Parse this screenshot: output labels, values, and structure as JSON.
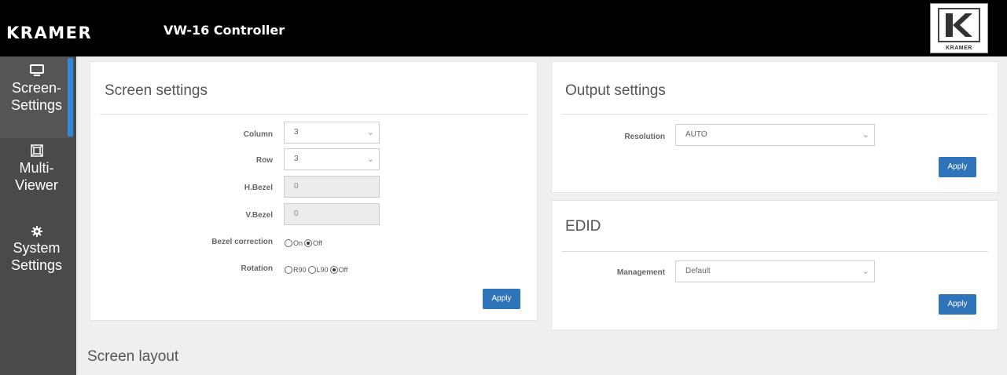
{
  "header": {
    "brand": "KRAMER",
    "app_title": "VW-16 Controller",
    "logo_text": "KRAMER",
    "background": "#000000"
  },
  "sidebar": {
    "accent": "#2f8ad8",
    "items": [
      {
        "line1": "Screen-",
        "line2": "Settings",
        "icon": "monitor-icon",
        "active": true
      },
      {
        "line1": "Multi-",
        "line2": "Viewer",
        "icon": "multiviewer-icon",
        "active": false
      },
      {
        "line1": "System",
        "line2": "Settings",
        "icon": "gear-icon",
        "active": false
      }
    ]
  },
  "screen_settings": {
    "title": "Screen settings",
    "column_label": "Column",
    "column_value": "3",
    "row_label": "Row",
    "row_value": "3",
    "hbezel_label": "H.Bezel",
    "hbezel_value": "0",
    "vbezel_label": "V.Bezel",
    "vbezel_value": "0",
    "bezel_correction_label": "Bezel correction",
    "bezel_correction_options": [
      "On",
      "Off"
    ],
    "bezel_correction_selected": "Off",
    "rotation_label": "Rotation",
    "rotation_options": [
      "R90",
      "L90",
      "Off"
    ],
    "rotation_selected": "Off",
    "apply_label": "Apply"
  },
  "output_settings": {
    "title": "Output settings",
    "resolution_label": "Resolution",
    "resolution_value": "AUTO",
    "apply_label": "Apply"
  },
  "edid": {
    "title": "EDID",
    "management_label": "Management",
    "management_value": "Default",
    "apply_label": "Apply"
  },
  "screen_layout": {
    "title": "Screen layout"
  },
  "colors": {
    "button": "#2f73b8",
    "sidebar": "#4a4a4a",
    "page_bg": "#efefef"
  }
}
